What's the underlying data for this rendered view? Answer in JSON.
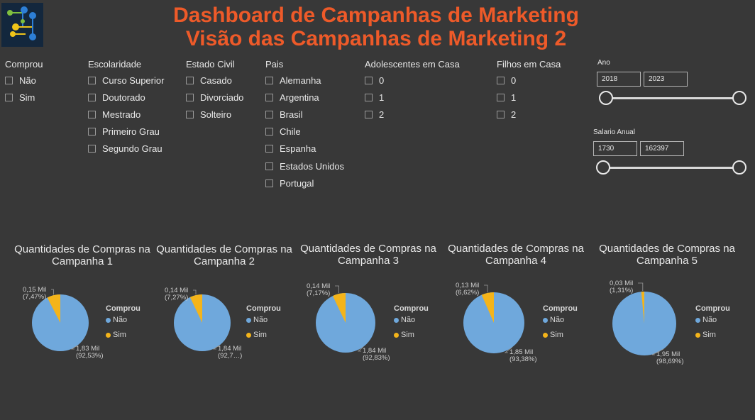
{
  "header": {
    "title_line1": "Dashboard de Campanhas de Marketing",
    "title_line2": "Visão das Campanhas de Marketing 2"
  },
  "filters": {
    "comprou": {
      "title": "Comprou",
      "options": [
        "Não",
        "Sim"
      ]
    },
    "escolaridade": {
      "title": "Escolaridade",
      "options": [
        "Curso Superior",
        "Doutorado",
        "Mestrado",
        "Primeiro Grau",
        "Segundo Grau"
      ]
    },
    "estado_civil": {
      "title": "Estado Civil",
      "options": [
        "Casado",
        "Divorciado",
        "Solteiro"
      ]
    },
    "pais": {
      "title": "Pais",
      "options": [
        "Alemanha",
        "Argentina",
        "Brasil",
        "Chile",
        "Espanha",
        "Estados Unidos",
        "Portugal"
      ]
    },
    "adolescentes": {
      "title": "Adolescentes em Casa",
      "options": [
        "0",
        "1",
        "2"
      ]
    },
    "filhos": {
      "title": "Filhos em Casa",
      "options": [
        "0",
        "1",
        "2"
      ]
    }
  },
  "sliders": {
    "ano": {
      "label": "Ano",
      "min": "2018",
      "max": "2023"
    },
    "salario": {
      "label": "Salario Anual",
      "min": "1730",
      "max": "162397"
    }
  },
  "colors": {
    "nao": "#6fa8dc",
    "sim": "#f4b41a",
    "title": "#ee5a29"
  },
  "legend": {
    "title": "Comprou",
    "nao": "Não",
    "sim": "Sim"
  },
  "chart_data": [
    {
      "type": "pie",
      "title": "Quantidades de Compras na Campanha 1",
      "categories": [
        "Não",
        "Sim"
      ],
      "values": [
        1830,
        150
      ],
      "labels": {
        "sim_value": "0,15 Mil",
        "sim_pct": "(7,47%)",
        "nao_value": "1,83 Mil",
        "nao_pct": "(92,53%)"
      }
    },
    {
      "type": "pie",
      "title": "Quantidades de Compras na Campanha 2",
      "categories": [
        "Não",
        "Sim"
      ],
      "values": [
        1840,
        140
      ],
      "labels": {
        "sim_value": "0,14 Mil",
        "sim_pct": "(7,27%)",
        "nao_value": "1,84 Mil",
        "nao_pct": "(92,7…)"
      }
    },
    {
      "type": "pie",
      "title": "Quantidades de Compras na Campanha 3",
      "categories": [
        "Não",
        "Sim"
      ],
      "values": [
        1840,
        140
      ],
      "labels": {
        "sim_value": "0,14 Mil",
        "sim_pct": "(7,17%)",
        "nao_value": "1,84 Mil",
        "nao_pct": "(92,83%)"
      }
    },
    {
      "type": "pie",
      "title": "Quantidades de Compras na Campanha 4",
      "categories": [
        "Não",
        "Sim"
      ],
      "values": [
        1850,
        130
      ],
      "labels": {
        "sim_value": "0,13 Mil",
        "sim_pct": "(6,62%)",
        "nao_value": "1,85 Mil",
        "nao_pct": "(93,38%)"
      }
    },
    {
      "type": "pie",
      "title": "Quantidades de Compras na Campanha 5",
      "categories": [
        "Não",
        "Sim"
      ],
      "values": [
        1950,
        30
      ],
      "labels": {
        "sim_value": "0,03 Mil",
        "sim_pct": "(1,31%)",
        "nao_value": "1,95 Mil",
        "nao_pct": "(98,69%)"
      }
    }
  ]
}
